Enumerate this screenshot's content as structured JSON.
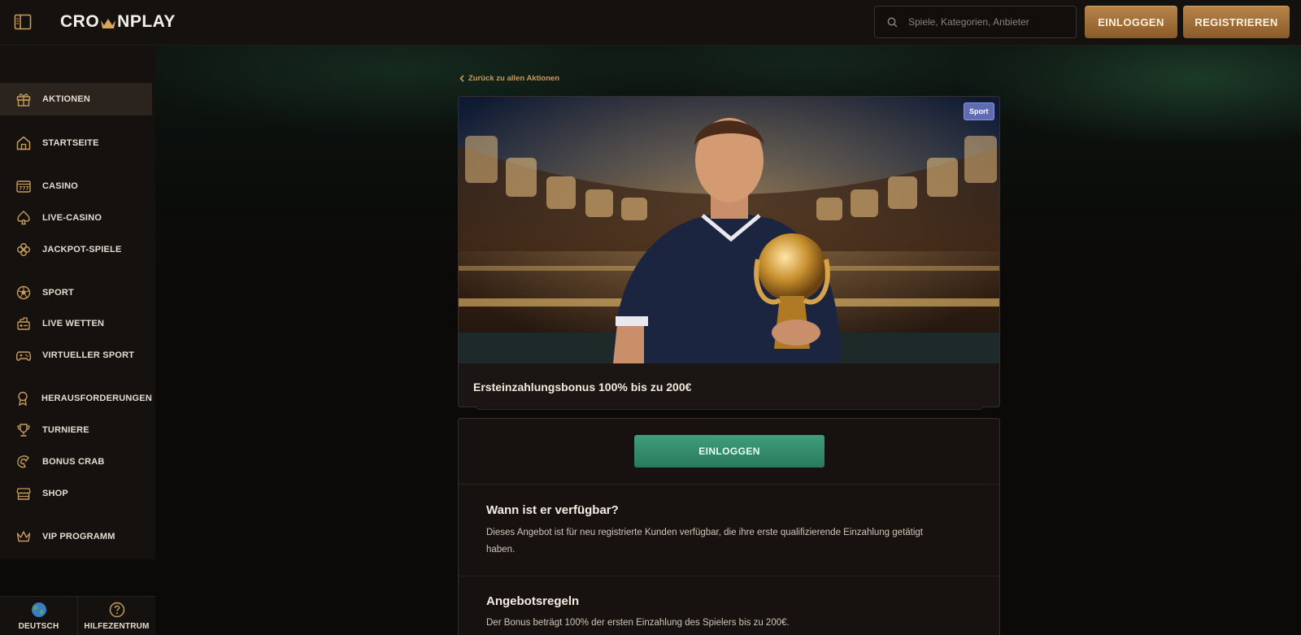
{
  "header": {
    "logo_text_left": "CRO",
    "logo_text_right": "NPLAY",
    "search": {
      "placeholder": "Spiele, Kategorien, Anbieter"
    },
    "login_label": "EINLOGGEN",
    "register_label": "REGISTRIEREN"
  },
  "sidebar": {
    "items": [
      {
        "label": "AKTIONEN",
        "icon": "gift-icon",
        "active": true
      },
      {
        "label": "STARTSEITE",
        "icon": "home-icon"
      },
      {
        "label": "CASINO",
        "icon": "slot-machine-icon"
      },
      {
        "label": "LIVE-CASINO",
        "icon": "spade-icon"
      },
      {
        "label": "JACKPOT-SPIELE",
        "icon": "clover-icon"
      },
      {
        "label": "SPORT",
        "icon": "soccer-ball-icon"
      },
      {
        "label": "LIVE WETTEN",
        "icon": "live-betting-icon"
      },
      {
        "label": "VIRTUELLER SPORT",
        "icon": "gamepad-icon"
      },
      {
        "label": "HERAUSFORDERUNGEN",
        "icon": "medal-icon"
      },
      {
        "label": "TURNIERE",
        "icon": "trophy-icon"
      },
      {
        "label": "BONUS CRAB",
        "icon": "crab-claw-icon"
      },
      {
        "label": "SHOP",
        "icon": "shop-icon"
      },
      {
        "label": "VIP PROGRAMM",
        "icon": "crown-icon"
      }
    ],
    "bottom": {
      "language_label": "DEUTSCH",
      "help_label": "HILFEZENTRUM"
    }
  },
  "main": {
    "back_link": "Zurück zu allen Aktionen",
    "promo": {
      "badge": "Sport",
      "title": "Ersteinzahlungsbonus 100% bis zu 200€"
    },
    "cta_label": "EINLOGGEN",
    "sections": [
      {
        "title": "Wann ist er verfügbar?",
        "text_line1": "Dieses Angebot ist für neu registrierte Kunden verfügbar, die ihre erste qualifizierende Einzahlung getätigt",
        "text_line2": "haben."
      },
      {
        "title": "Angebotsregeln",
        "text_line1": "Der Bonus beträgt 100% der ersten Einzahlung des Spielers bis zu 200€."
      }
    ]
  },
  "colors": {
    "gold_accent": "#c79b5a",
    "green_button": "#3f9e7c",
    "sport_badge": "#5f6bb5",
    "background": "#0c0a09"
  }
}
